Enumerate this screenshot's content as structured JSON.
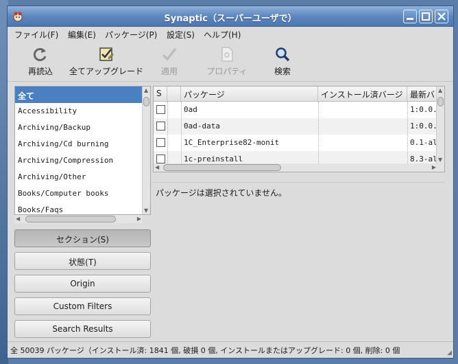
{
  "window": {
    "title": "Synaptic（スーパーユーザで）"
  },
  "menubar": {
    "items": [
      "ファイル(F)",
      "編集(E)",
      "パッケージ(P)",
      "設定(S)",
      "ヘルプ(H)"
    ]
  },
  "toolbar": {
    "reload_label": "再読込",
    "upgrade_all_label": "全てアップグレード",
    "apply_label": "適用",
    "properties_label": "プロパティ",
    "search_label": "検索"
  },
  "sections": {
    "items": [
      "全て",
      "Accessibility",
      "Archiving/Backup",
      "Archiving/Cd burning",
      "Archiving/Compression",
      "Archiving/Other",
      "Books/Computer books",
      "Books/Faqs"
    ]
  },
  "filters": {
    "sections_label": "セクション(S)",
    "status_label": "状態(T)",
    "origin_label": "Origin",
    "custom_label": "Custom Filters",
    "search_results_label": "Search Results"
  },
  "packages": {
    "columns": [
      "S",
      "",
      "パッケージ",
      "インストール済バージ",
      "最新バ"
    ],
    "rows": [
      {
        "name": "0ad",
        "installed": "",
        "latest": "1:0.0."
      },
      {
        "name": "0ad-data",
        "installed": "",
        "latest": "1:0.0."
      },
      {
        "name": "1C_Enterprise82-monit",
        "installed": "",
        "latest": "0.1-al"
      },
      {
        "name": "1c-preinstall",
        "installed": "",
        "latest": "8.3-al"
      }
    ]
  },
  "description": {
    "text": "パッケージは選択されていません。"
  },
  "status": {
    "text": "全 50039 パッケージ（インストール済: 1841 個, 破損 0 個, インストールまたはアップグレード: 0 個, 削除: 0 個"
  },
  "colors": {
    "selection": "#4a7fc1",
    "titlebar": "#5f87bd",
    "window_bg": "#dcdcdc"
  }
}
